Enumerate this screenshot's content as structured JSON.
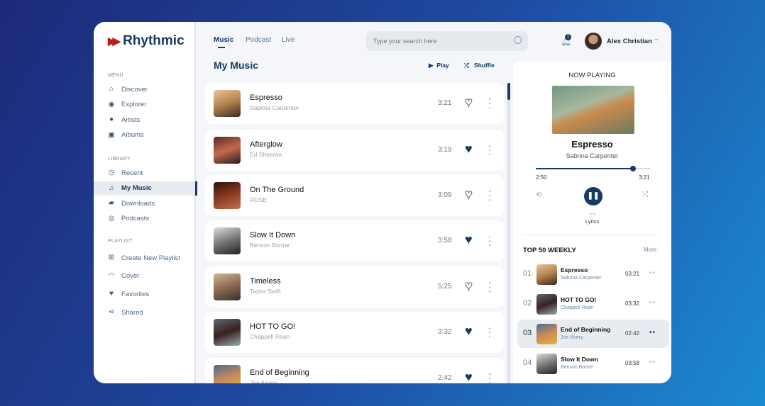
{
  "app": {
    "name": "Rhythmic"
  },
  "sidebar": {
    "sections": [
      {
        "label": "MENU",
        "items": [
          {
            "label": "Discover",
            "icon": "home-icon"
          },
          {
            "label": "Explorer",
            "icon": "compass-icon"
          },
          {
            "label": "Artists",
            "icon": "user-icon"
          },
          {
            "label": "Albums",
            "icon": "album-icon"
          }
        ]
      },
      {
        "label": "LIBRARY",
        "items": [
          {
            "label": "Recent",
            "icon": "clock-icon"
          },
          {
            "label": "My Music",
            "icon": "music-note-icon",
            "active": true
          },
          {
            "label": "Downloads",
            "icon": "download-folder-icon"
          },
          {
            "label": "Podcasts",
            "icon": "podcast-icon"
          }
        ]
      },
      {
        "label": "PLAYLIST",
        "items": [
          {
            "label": "Create New Playlist",
            "icon": "add-playlist-icon"
          },
          {
            "label": "Cover",
            "icon": "headphones-icon"
          },
          {
            "label": "Favorites",
            "icon": "heart-icon"
          },
          {
            "label": "Shared",
            "icon": "share-icon"
          }
        ]
      }
    ]
  },
  "header": {
    "tabs": [
      "Music",
      "Podcast",
      "Live"
    ],
    "active_tab": "Music",
    "search_placeholder": "Type your search here",
    "notification_count": "1",
    "user_name": "Alex Christian"
  },
  "main": {
    "title": "My Music",
    "play_label": "Play",
    "shuffle_label": "Shuffle",
    "songs": [
      {
        "title": "Espresso",
        "artist": "Sabrina Carpenter",
        "duration": "3:21",
        "liked": false
      },
      {
        "title": "Afterglow",
        "artist": "Ed Sheeran",
        "duration": "3:19",
        "liked": true
      },
      {
        "title": "On The Ground",
        "artist": "ROSE",
        "duration": "3:09",
        "liked": false
      },
      {
        "title": "Slow It Down",
        "artist": "Benson Boone",
        "duration": "3:58",
        "liked": true
      },
      {
        "title": "Timeless",
        "artist": "Taylor Swift",
        "duration": "5:25",
        "liked": false
      },
      {
        "title": "HOT TO GO!",
        "artist": "Chappell Roan",
        "duration": "3:32",
        "liked": true
      },
      {
        "title": "End of Beginning",
        "artist": "Joe Keery",
        "duration": "2:42",
        "liked": true
      }
    ]
  },
  "now_playing": {
    "heading": "NOW PLAYING",
    "title": "Espresso",
    "artist": "Sabrina Carpenter",
    "elapsed": "2:50",
    "total": "3:21",
    "progress": 0.85,
    "lyrics_label": "Lyrics"
  },
  "top50": {
    "heading": "TOP 50 WEEKLY",
    "more_label": "More",
    "items": [
      {
        "rank": "01",
        "title": "Espresso",
        "artist": "Sabrina Carpenter",
        "duration": "03:21"
      },
      {
        "rank": "02",
        "title": "HOT TO GO!",
        "artist": "Chappell Roan",
        "duration": "03:32"
      },
      {
        "rank": "03",
        "title": "End of Beginning",
        "artist": "Joe Keery",
        "duration": "02:42",
        "active": true
      },
      {
        "rank": "04",
        "title": "Slow It Down",
        "artist": "Benson Boone",
        "duration": "03:58"
      }
    ]
  },
  "colors": {
    "accent": "#163a63",
    "logo_red": "#b5201e"
  }
}
